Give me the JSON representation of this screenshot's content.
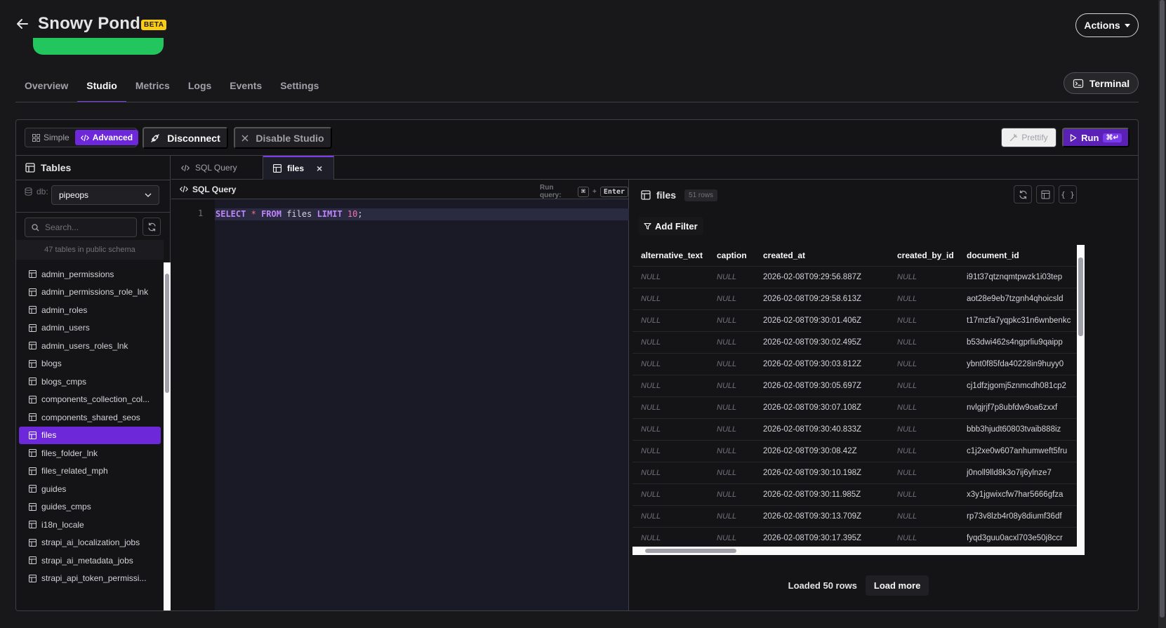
{
  "header": {
    "title": "Snowy Pond",
    "badge": "BETA",
    "actions_label": "Actions"
  },
  "tabs": [
    "Overview",
    "Studio",
    "Metrics",
    "Logs",
    "Events",
    "Settings"
  ],
  "active_tab": "Studio",
  "terminal_label": "Terminal",
  "toolbar": {
    "simple_label": "Simple",
    "advanced_label": "Advanced",
    "disconnect_label": "Disconnect",
    "disable_label": "Disable Studio",
    "prettify_label": "Prettify",
    "run_label": "Run",
    "run_shortcut": "⌘↵"
  },
  "sidebar": {
    "title": "Tables",
    "db_label": "db:",
    "db_value": "pipeops",
    "search_placeholder": "Search...",
    "tables_count": "47 tables in public schema",
    "tables": [
      "admin_permissions",
      "admin_permissions_role_lnk",
      "admin_roles",
      "admin_users",
      "admin_users_roles_lnk",
      "blogs",
      "blogs_cmps",
      "components_collection_col...",
      "components_shared_seos",
      "files",
      "files_folder_lnk",
      "files_related_mph",
      "guides",
      "guides_cmps",
      "i18n_locale",
      "strapi_ai_localization_jobs",
      "strapi_ai_metadata_jobs",
      "strapi_api_token_permissi..."
    ],
    "selected_table": "files"
  },
  "editor": {
    "tabs": [
      {
        "label": "SQL Query",
        "active": false
      },
      {
        "label": "files",
        "active": true
      }
    ],
    "pane_title": "SQL Query",
    "run_hint": "Run query:",
    "run_key1": "⌘",
    "run_plus": "+",
    "run_key2": "Enter",
    "line_number": "1",
    "code": {
      "kw1": "SELECT",
      "star": "*",
      "kw2": "FROM",
      "table": "files",
      "kw3": "LIMIT",
      "limit": "10",
      "end": ";"
    }
  },
  "results": {
    "title": "files",
    "row_count": "51 rows",
    "add_filter_label": "Add Filter",
    "columns": [
      "alternative_text",
      "caption",
      "created_at",
      "created_by_id",
      "document_id"
    ],
    "null_text": "NULL",
    "rows": [
      [
        "2026-02-08T09:29:56.887Z",
        "i91t37qtznqmtpwzk1i03tep"
      ],
      [
        "2026-02-08T09:29:58.613Z",
        "aot28e9eb7tzgnh4qhoicsld"
      ],
      [
        "2026-02-08T09:30:01.406Z",
        "t17mzfa7yqpkc31n6wnbenkc"
      ],
      [
        "2026-02-08T09:30:02.495Z",
        "b53dwi462s4ngprliu9qaipp"
      ],
      [
        "2026-02-08T09:30:03.812Z",
        "ybnt0f85fda40228in9huyy0"
      ],
      [
        "2026-02-08T09:30:05.697Z",
        "cj1dfzjgomj5znmcdh081cp2"
      ],
      [
        "2026-02-08T09:30:07.108Z",
        "nvlgjrjf7p8ubfdw9oa6zxxf"
      ],
      [
        "2026-02-08T09:30:40.833Z",
        "bbb3hjudt60803tvaib888iz"
      ],
      [
        "2026-02-08T09:30:08.42Z",
        "c1j2xe0w607anhumweft5fru"
      ],
      [
        "2026-02-08T09:30:10.198Z",
        "j0noll9lld8k3o7ij6ylnze7"
      ],
      [
        "2026-02-08T09:30:11.985Z",
        "x3y1jgwixcfw7har5666gfza"
      ],
      [
        "2026-02-08T09:30:13.709Z",
        "rp73v8lzb4r08y8diumf36df"
      ],
      [
        "2026-02-08T09:30:17.395Z",
        "fyqd3guu0acxl703e50j8ccr"
      ]
    ],
    "loaded_text": "Loaded 50 rows",
    "load_more_label": "Load more"
  },
  "colors": {
    "accent": "#6d28d9",
    "beta": "#facc15",
    "status": "#22c55e"
  }
}
